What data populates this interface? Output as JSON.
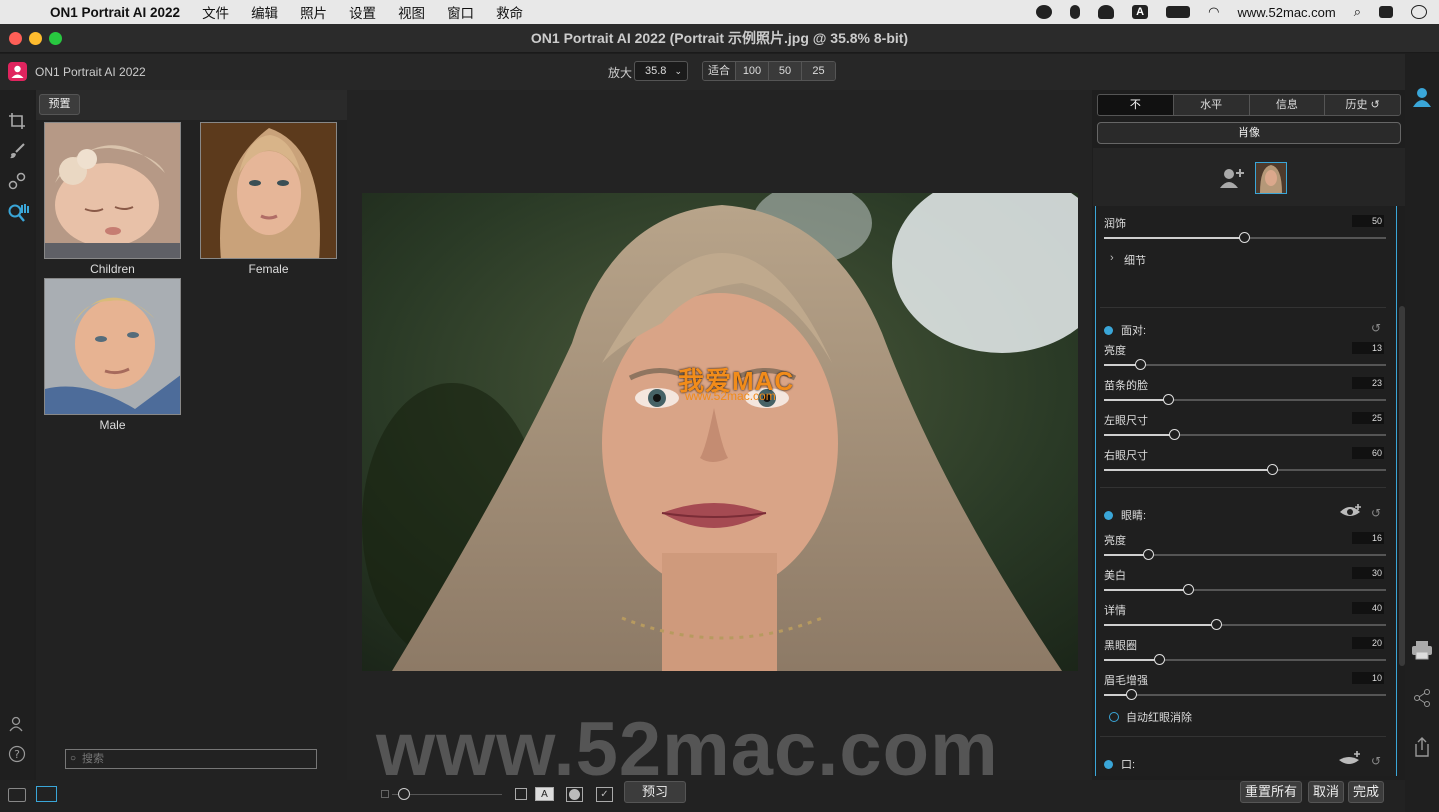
{
  "menubar": {
    "app_name": "ON1 Portrait AI 2022",
    "items": [
      "文件",
      "编辑",
      "照片",
      "设置",
      "视图",
      "窗口",
      "救命"
    ],
    "site_text": "www.52mac.com"
  },
  "window": {
    "title": "ON1 Portrait AI 2022 (Portrait 示例照片.jpg @ 35.8% 8-bit)"
  },
  "toolbar": {
    "app_title": "ON1 Portrait AI 2022",
    "zoom_label": "放大",
    "zoom_value": "35.8",
    "zoom_buttons": [
      "适合",
      "100",
      "50",
      "25"
    ]
  },
  "presets": {
    "header_button": "预置",
    "items": [
      {
        "label": "Children"
      },
      {
        "label": "Female"
      },
      {
        "label": "Male"
      }
    ],
    "search_placeholder": "搜索"
  },
  "canvas": {
    "photo_logo_text": "我爱MAC",
    "photo_logo_sub": "www.52mac.com",
    "watermark": "www.52mac.com"
  },
  "bottom": {
    "preview_label": "预习",
    "reset_all_label": "重置所有",
    "cancel_label": "取消",
    "done_label": "完成"
  },
  "right_panel": {
    "tabs": [
      "不",
      "水平",
      "信息",
      "历史"
    ],
    "active_tab": "不",
    "portrait_button": "肖像",
    "retouch": {
      "label": "润饰",
      "value": 50
    },
    "detail_label": "细节",
    "face": {
      "title": "面对:",
      "sliders": [
        {
          "label": "亮度",
          "value": 13
        },
        {
          "label": "苗条的脸",
          "value": 23
        },
        {
          "label": "左眼尺寸",
          "value": 25
        },
        {
          "label": "右眼尺寸",
          "value": 60
        }
      ]
    },
    "eyes": {
      "title": "眼睛:",
      "sliders": [
        {
          "label": "亮度",
          "value": 16
        },
        {
          "label": "美白",
          "value": 30
        },
        {
          "label": "详情",
          "value": 40
        },
        {
          "label": "黑眼圈",
          "value": 20
        },
        {
          "label": "眉毛增强",
          "value": 10
        }
      ],
      "redeye_label": "自动红眼消除"
    },
    "mouth": {
      "title": "口:"
    }
  }
}
